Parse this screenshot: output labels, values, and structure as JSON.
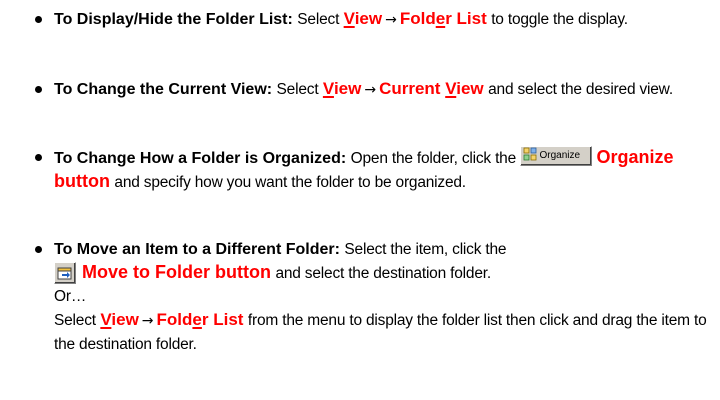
{
  "items": [
    {
      "heading": "To Display/Hide the Folder List:",
      "parts": {
        "select": "Select",
        "menu1_u": "V",
        "menu1_rest": "iew",
        "arrow": "→",
        "menu2_a": "Fold",
        "menu2_u": "e",
        "menu2_b": "r List",
        "tail": "to toggle the display."
      }
    },
    {
      "heading": "To Change the Current View:",
      "parts": {
        "select": "Select",
        "menu1_u": "V",
        "menu1_rest": "iew",
        "arrow": "→",
        "menu2_a": "Current ",
        "menu2_u": "V",
        "menu2_b": "iew",
        "tail": "and select the desired view."
      }
    },
    {
      "heading": "To Change How a Folder is Organized:",
      "parts": {
        "lead": "Open the folder, click the",
        "button_caption": "Organize",
        "button_name": "Organize button",
        "tail": "and specify how you want the folder to be organized.",
        "icon": "organize-icon"
      }
    },
    {
      "heading": "To Move an Item to a Different Folder:",
      "parts": {
        "lead": "Select the item, click the",
        "button_name": "Move to Folder button",
        "tail": "and select the destination folder.",
        "or": "Or…",
        "select": "Select",
        "menu1_u": "V",
        "menu1_rest": "iew",
        "arrow": "→",
        "menu2_a": "Fold",
        "menu2_u": "e",
        "menu2_b": "r List",
        "tail2": "from the menu to display the folder list then click and drag the item to the destination folder.",
        "icon": "move-to-folder-icon"
      }
    }
  ],
  "colors": {
    "accent": "#ff0000",
    "text": "#000000",
    "button_face": "#d4d0c8"
  }
}
